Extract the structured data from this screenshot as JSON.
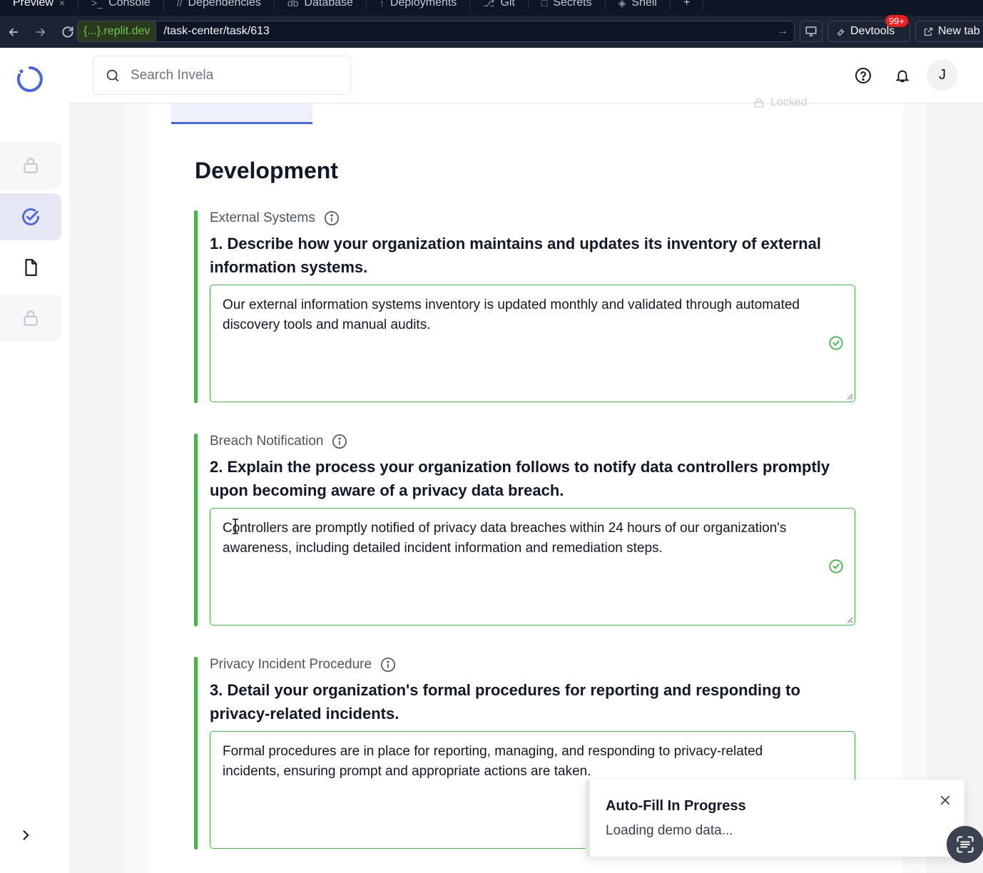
{
  "browser": {
    "tabs": [
      {
        "label": "Preview",
        "icon": ""
      },
      {
        "label": "Console",
        "icon": ">_"
      },
      {
        "label": "Dependencies",
        "icon": "//"
      },
      {
        "label": "Database",
        "icon": "db"
      },
      {
        "label": "Deployments",
        "icon": "↑"
      },
      {
        "label": "Git",
        "icon": "⎇"
      },
      {
        "label": "Secrets",
        "icon": "□"
      },
      {
        "label": "Shell",
        "icon": "◈"
      }
    ],
    "close_glyph": "×",
    "add_tab_glyph": "+",
    "url_domain": "{...}.replit.dev",
    "url_path": "/task-center/task/613",
    "devtools_label": "Devtools",
    "devtools_badge": "99+",
    "new_tab_label": "New tab"
  },
  "header": {
    "search_placeholder": "Search Invela",
    "avatar_initial": "J"
  },
  "progress": {
    "locked_label": "Locked"
  },
  "section": {
    "title": "Development"
  },
  "questions": [
    {
      "category": "External Systems",
      "text": "1. Describe how your organization maintains and updates its inventory of external information systems.",
      "answer": "Our external information systems inventory is updated monthly and validated through automated discovery tools and manual audits."
    },
    {
      "category": "Breach Notification",
      "text": "2. Explain the process your organization follows to notify data controllers promptly upon becoming aware of a privacy data breach.",
      "answer": "Controllers are promptly notified of privacy data breaches within 24 hours of our organization's awareness, including detailed incident information and remediation steps."
    },
    {
      "category": "Privacy Incident Procedure",
      "text": "3. Detail your organization's formal procedures for reporting and responding to privacy-related incidents.",
      "answer": "Formal procedures are in place for reporting, managing, and responding to privacy-related incidents, ensuring prompt and appropriate actions are taken."
    }
  ],
  "toast": {
    "title": "Auto-Fill In Progress",
    "message": "Loading demo data..."
  },
  "colors": {
    "accent": "#4965d6",
    "success": "#4caf50"
  }
}
